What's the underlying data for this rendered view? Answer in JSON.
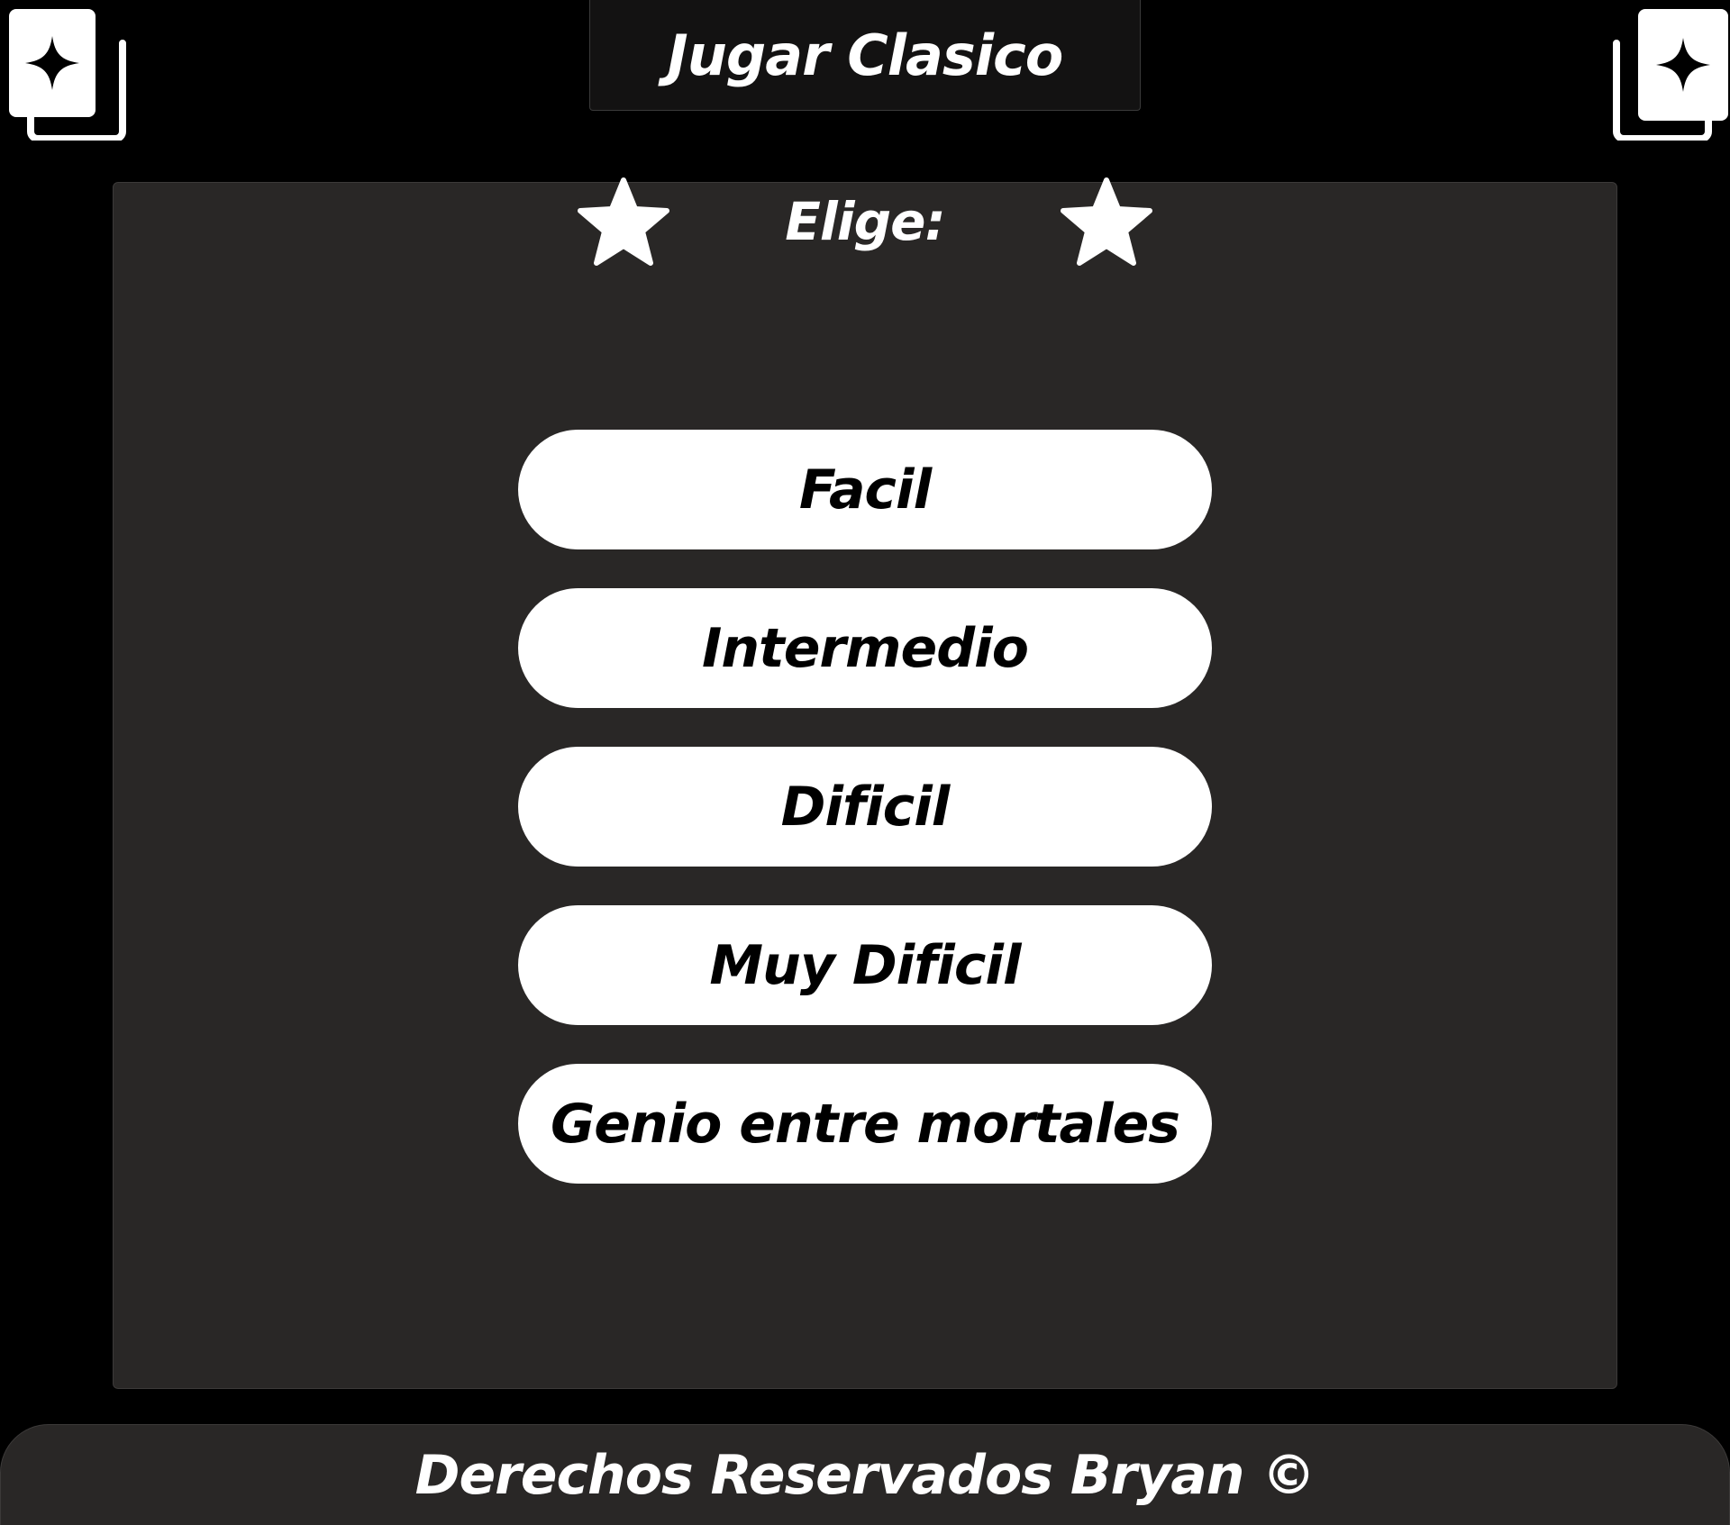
{
  "header": {
    "title": "Jugar Clasico",
    "left_icon": "cards-icon",
    "right_icon": "cards-icon"
  },
  "panel": {
    "prompt": "Elige:",
    "decoration_icon": "star-icon",
    "options": [
      {
        "label": "Facil"
      },
      {
        "label": "Intermedio"
      },
      {
        "label": "Dificil"
      },
      {
        "label": "Muy Dificil"
      },
      {
        "label": "Genio entre mortales"
      }
    ]
  },
  "footer": {
    "text": "Derechos Reservados Bryan ©"
  },
  "colors": {
    "background": "#000000",
    "panel": "#292726",
    "button": "#ffffff",
    "button_text": "#000000",
    "text": "#ffffff"
  }
}
